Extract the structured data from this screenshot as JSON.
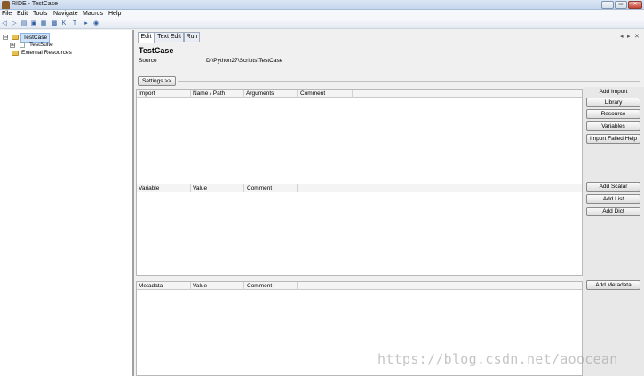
{
  "window": {
    "title": "RIDE - TestCase",
    "min": "–",
    "max": "▭",
    "close": "✕"
  },
  "menu": [
    "File",
    "Edit",
    "Tools",
    "Navigate",
    "Macros",
    "Help"
  ],
  "toolbar": {
    "icons": [
      "◁",
      "▷",
      "▤",
      "▣",
      "▦",
      "▩",
      "K",
      "T",
      "▸",
      "◉"
    ]
  },
  "tree": {
    "root": {
      "label": "TestCase",
      "expander": "⊟"
    },
    "child": {
      "label": "TestSuite",
      "expander": "⊞"
    },
    "external": {
      "label": "External Resources"
    }
  },
  "tabs": [
    {
      "label": "Edit"
    },
    {
      "label": "Text Edit"
    },
    {
      "label": "Run"
    }
  ],
  "tab_controls": {
    "prev": "◂",
    "next": "▸",
    "close": "✕"
  },
  "editor": {
    "title": "TestCase",
    "source_label": "Source",
    "source_value": "D:\\Python27\\Scripts\\TestCase",
    "settings_button": "Settings >>"
  },
  "import_table": {
    "headers": [
      "Import",
      "Name / Path",
      "Arguments",
      "Comment"
    ]
  },
  "variable_table": {
    "headers": [
      "Variable",
      "Value",
      "Comment"
    ]
  },
  "metadata_table": {
    "headers": [
      "Metadata",
      "Value",
      "Comment"
    ]
  },
  "side": {
    "add_import_label": "Add Import",
    "library": "Library",
    "resource": "Resource",
    "variables": "Variables",
    "import_failed_help": "Import Failed Help",
    "add_scalar": "Add Scalar",
    "add_list": "Add List",
    "add_dict": "Add Dict",
    "add_metadata": "Add Metadata"
  },
  "watermark": "https://blog.csdn.net/aoocean"
}
